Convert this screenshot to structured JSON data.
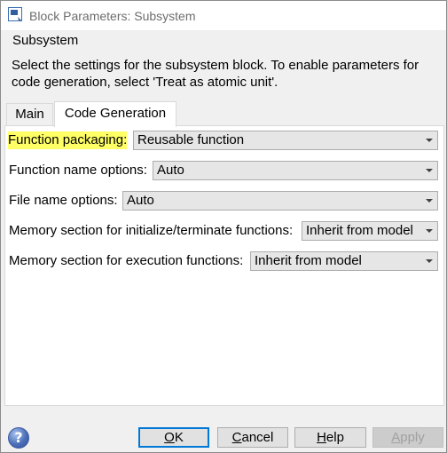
{
  "window": {
    "title": "Block Parameters: Subsystem",
    "icon": "simulink-block-icon"
  },
  "group": {
    "label": "Subsystem",
    "description": "Select the settings for the subsystem block. To enable parameters for code generation, select 'Treat as atomic unit'."
  },
  "tabs": [
    {
      "label": "Main",
      "active": false
    },
    {
      "label": "Code Generation",
      "active": true
    }
  ],
  "fields": {
    "function_packaging": {
      "label": "Function packaging:",
      "value": "Reusable function",
      "highlighted": true
    },
    "function_name_options": {
      "label": "Function name options:",
      "value": "Auto"
    },
    "file_name_options": {
      "label": "File name options:",
      "value": "Auto"
    },
    "memory_init_term": {
      "label": "Memory section for initialize/terminate functions:",
      "value": "Inherit from model"
    },
    "memory_exec": {
      "label": "Memory section for execution functions:",
      "value": "Inherit from model"
    }
  },
  "buttons": {
    "ok": {
      "mnemonic": "O",
      "rest": "K"
    },
    "cancel": {
      "mnemonic": "C",
      "rest": "ancel"
    },
    "help": {
      "mnemonic": "H",
      "rest": "elp"
    },
    "apply": {
      "mnemonic": "A",
      "rest": "pply",
      "disabled": true
    },
    "help_icon": "?"
  },
  "colors": {
    "highlight": "#ffff66",
    "default_button_border": "#0078d7"
  }
}
